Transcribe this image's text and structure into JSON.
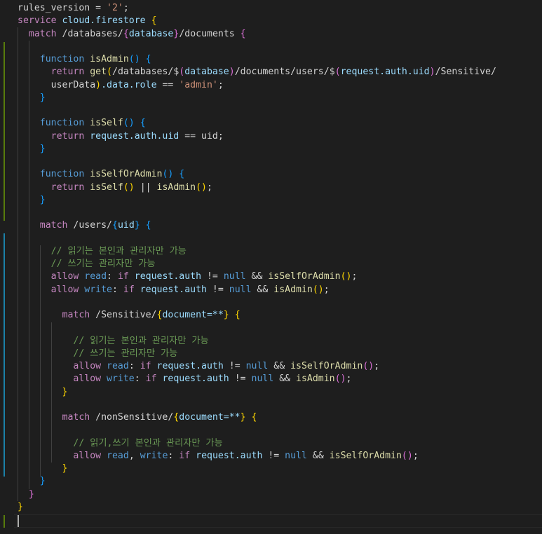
{
  "editor": {
    "language": "firestore-rules",
    "theme_background": "#1e1e1e",
    "lines": [
      [
        {
          "t": "rules_version = ",
          "c": "plain"
        },
        {
          "t": "'2'",
          "c": "str"
        },
        {
          "t": ";",
          "c": "plain"
        }
      ],
      [
        {
          "t": "service ",
          "c": "kw"
        },
        {
          "t": "cloud.firestore ",
          "c": "var"
        },
        {
          "t": "{",
          "c": "b1"
        }
      ],
      [
        {
          "t": "  match ",
          "c": "kw"
        },
        {
          "t": "/databases/",
          "c": "plain"
        },
        {
          "t": "{",
          "c": "b2"
        },
        {
          "t": "database",
          "c": "var"
        },
        {
          "t": "}",
          "c": "b2"
        },
        {
          "t": "/documents ",
          "c": "plain"
        },
        {
          "t": "{",
          "c": "b2"
        }
      ],
      [
        {
          "t": "",
          "c": "plain"
        }
      ],
      [
        {
          "t": "    function ",
          "c": "kw2"
        },
        {
          "t": "isAdmin",
          "c": "fn"
        },
        {
          "t": "() ",
          "c": "b3"
        },
        {
          "t": "{",
          "c": "b3"
        }
      ],
      [
        {
          "t": "      return ",
          "c": "kw"
        },
        {
          "t": "get",
          "c": "fn"
        },
        {
          "t": "(",
          "c": "b1"
        },
        {
          "t": "/databases/$",
          "c": "plain"
        },
        {
          "t": "(",
          "c": "b2"
        },
        {
          "t": "database",
          "c": "var"
        },
        {
          "t": ")",
          "c": "b2"
        },
        {
          "t": "/documents/users/$",
          "c": "plain"
        },
        {
          "t": "(",
          "c": "b2"
        },
        {
          "t": "request.auth.uid",
          "c": "var"
        },
        {
          "t": ")",
          "c": "b2"
        },
        {
          "t": "/Sensitive/",
          "c": "plain"
        }
      ],
      [
        {
          "t": "      userData",
          "c": "plain"
        },
        {
          "t": ")",
          "c": "b1"
        },
        {
          "t": ".data.role",
          "c": "var"
        },
        {
          "t": " == ",
          "c": "plain"
        },
        {
          "t": "'admin'",
          "c": "str"
        },
        {
          "t": ";",
          "c": "plain"
        }
      ],
      [
        {
          "t": "    }",
          "c": "b3"
        }
      ],
      [
        {
          "t": "",
          "c": "plain"
        }
      ],
      [
        {
          "t": "    function ",
          "c": "kw2"
        },
        {
          "t": "isSelf",
          "c": "fn"
        },
        {
          "t": "() ",
          "c": "b3"
        },
        {
          "t": "{",
          "c": "b3"
        }
      ],
      [
        {
          "t": "      return ",
          "c": "kw"
        },
        {
          "t": "request.auth.uid",
          "c": "var"
        },
        {
          "t": " == uid;",
          "c": "plain"
        }
      ],
      [
        {
          "t": "    }",
          "c": "b3"
        }
      ],
      [
        {
          "t": "",
          "c": "plain"
        }
      ],
      [
        {
          "t": "    function ",
          "c": "kw2"
        },
        {
          "t": "isSelfOrAdmin",
          "c": "fn"
        },
        {
          "t": "() ",
          "c": "b3"
        },
        {
          "t": "{",
          "c": "b3"
        }
      ],
      [
        {
          "t": "      return ",
          "c": "kw"
        },
        {
          "t": "isSelf",
          "c": "fn"
        },
        {
          "t": "()",
          "c": "b1"
        },
        {
          "t": " || ",
          "c": "plain"
        },
        {
          "t": "isAdmin",
          "c": "fn"
        },
        {
          "t": "()",
          "c": "b1"
        },
        {
          "t": ";",
          "c": "plain"
        }
      ],
      [
        {
          "t": "    }",
          "c": "b3"
        }
      ],
      [
        {
          "t": "",
          "c": "plain"
        }
      ],
      [
        {
          "t": "    match ",
          "c": "kw"
        },
        {
          "t": "/users/",
          "c": "plain"
        },
        {
          "t": "{",
          "c": "b3"
        },
        {
          "t": "uid",
          "c": "var"
        },
        {
          "t": "}",
          "c": "b3"
        },
        {
          "t": " {",
          "c": "b3"
        }
      ],
      [
        {
          "t": "",
          "c": "plain"
        }
      ],
      [
        {
          "t": "      // 읽기는 본인과 관리자만 가능",
          "c": "cmt"
        }
      ],
      [
        {
          "t": "      // 쓰기는 관리자만 가능",
          "c": "cmt"
        }
      ],
      [
        {
          "t": "      allow ",
          "c": "kw"
        },
        {
          "t": "read",
          "c": "kw2"
        },
        {
          "t": ": ",
          "c": "plain"
        },
        {
          "t": "if ",
          "c": "kw"
        },
        {
          "t": "request.auth",
          "c": "var"
        },
        {
          "t": " != ",
          "c": "plain"
        },
        {
          "t": "null",
          "c": "kw2"
        },
        {
          "t": " && ",
          "c": "plain"
        },
        {
          "t": "isSelfOrAdmin",
          "c": "fn"
        },
        {
          "t": "()",
          "c": "b1"
        },
        {
          "t": ";",
          "c": "plain"
        }
      ],
      [
        {
          "t": "      allow ",
          "c": "kw"
        },
        {
          "t": "write",
          "c": "kw2"
        },
        {
          "t": ": ",
          "c": "plain"
        },
        {
          "t": "if ",
          "c": "kw"
        },
        {
          "t": "request.auth",
          "c": "var"
        },
        {
          "t": " != ",
          "c": "plain"
        },
        {
          "t": "null",
          "c": "kw2"
        },
        {
          "t": " && ",
          "c": "plain"
        },
        {
          "t": "isAdmin",
          "c": "fn"
        },
        {
          "t": "()",
          "c": "b1"
        },
        {
          "t": ";",
          "c": "plain"
        }
      ],
      [
        {
          "t": "",
          "c": "plain"
        }
      ],
      [
        {
          "t": "        match ",
          "c": "kw"
        },
        {
          "t": "/Sensitive/",
          "c": "plain"
        },
        {
          "t": "{",
          "c": "b1"
        },
        {
          "t": "document=**",
          "c": "var"
        },
        {
          "t": "}",
          "c": "b1"
        },
        {
          "t": " {",
          "c": "b1"
        }
      ],
      [
        {
          "t": "",
          "c": "plain"
        }
      ],
      [
        {
          "t": "          // 읽기는 본인과 관리자만 가능",
          "c": "cmt"
        }
      ],
      [
        {
          "t": "          // 쓰기는 관리자만 가능",
          "c": "cmt"
        }
      ],
      [
        {
          "t": "          allow ",
          "c": "kw"
        },
        {
          "t": "read",
          "c": "kw2"
        },
        {
          "t": ": ",
          "c": "plain"
        },
        {
          "t": "if ",
          "c": "kw"
        },
        {
          "t": "request.auth",
          "c": "var"
        },
        {
          "t": " != ",
          "c": "plain"
        },
        {
          "t": "null",
          "c": "kw2"
        },
        {
          "t": " && ",
          "c": "plain"
        },
        {
          "t": "isSelfOrAdmin",
          "c": "fn"
        },
        {
          "t": "()",
          "c": "b2"
        },
        {
          "t": ";",
          "c": "plain"
        }
      ],
      [
        {
          "t": "          allow ",
          "c": "kw"
        },
        {
          "t": "write",
          "c": "kw2"
        },
        {
          "t": ": ",
          "c": "plain"
        },
        {
          "t": "if ",
          "c": "kw"
        },
        {
          "t": "request.auth",
          "c": "var"
        },
        {
          "t": " != ",
          "c": "plain"
        },
        {
          "t": "null",
          "c": "kw2"
        },
        {
          "t": " && ",
          "c": "plain"
        },
        {
          "t": "isAdmin",
          "c": "fn"
        },
        {
          "t": "()",
          "c": "b2"
        },
        {
          "t": ";",
          "c": "plain"
        }
      ],
      [
        {
          "t": "        }",
          "c": "b1"
        }
      ],
      [
        {
          "t": "",
          "c": "plain"
        }
      ],
      [
        {
          "t": "        match ",
          "c": "kw"
        },
        {
          "t": "/nonSensitive/",
          "c": "plain"
        },
        {
          "t": "{",
          "c": "b1"
        },
        {
          "t": "document=**",
          "c": "var"
        },
        {
          "t": "}",
          "c": "b1"
        },
        {
          "t": " {",
          "c": "b1"
        }
      ],
      [
        {
          "t": "",
          "c": "plain"
        }
      ],
      [
        {
          "t": "          // 읽기,쓰기 본인과 관리자만 가능",
          "c": "cmt"
        }
      ],
      [
        {
          "t": "          allow ",
          "c": "kw"
        },
        {
          "t": "read",
          "c": "kw2"
        },
        {
          "t": ", ",
          "c": "plain"
        },
        {
          "t": "write",
          "c": "kw2"
        },
        {
          "t": ": ",
          "c": "plain"
        },
        {
          "t": "if ",
          "c": "kw"
        },
        {
          "t": "request.auth",
          "c": "var"
        },
        {
          "t": " != ",
          "c": "plain"
        },
        {
          "t": "null",
          "c": "kw2"
        },
        {
          "t": " && ",
          "c": "plain"
        },
        {
          "t": "isSelfOrAdmin",
          "c": "fn"
        },
        {
          "t": "()",
          "c": "b2"
        },
        {
          "t": ";",
          "c": "plain"
        }
      ],
      [
        {
          "t": "        }",
          "c": "b1"
        }
      ],
      [
        {
          "t": "    }",
          "c": "b3"
        }
      ],
      [
        {
          "t": "  }",
          "c": "b2"
        }
      ],
      [
        {
          "t": "}",
          "c": "b1"
        }
      ],
      [
        {
          "t": "",
          "c": "plain"
        }
      ]
    ]
  }
}
